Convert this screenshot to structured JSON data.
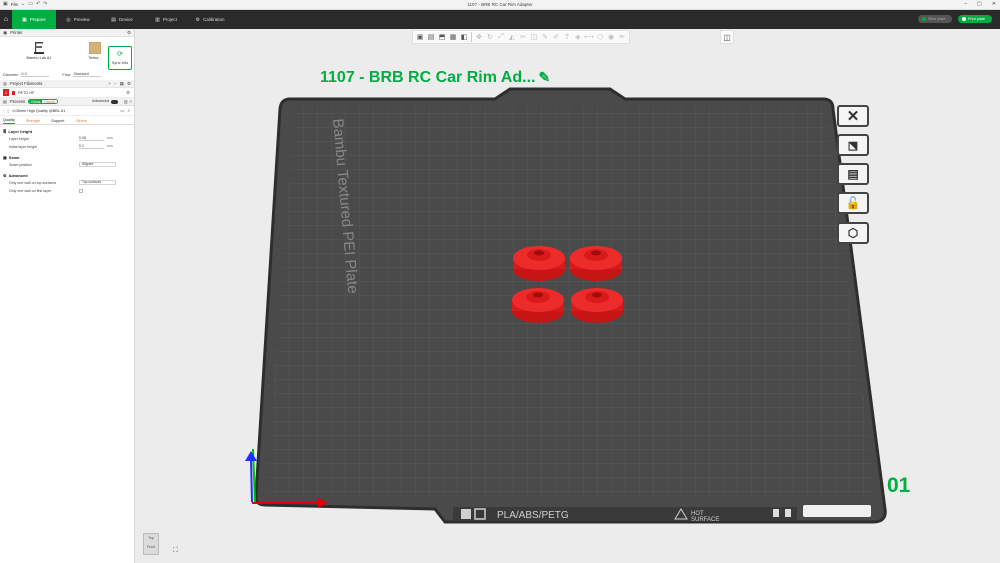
{
  "titlebar": {
    "title": "1107 - BRB RC Car Rim Adapter",
    "file_label": "File",
    "icons": [
      "chevron-down-icon",
      "save-icon",
      "undo-icon",
      "redo-icon"
    ],
    "window_controls": [
      "minimize-icon",
      "maximize-icon",
      "close-icon"
    ]
  },
  "nav": {
    "tabs": [
      {
        "label": "Prepare",
        "icon": "prepare-icon",
        "active": true
      },
      {
        "label": "Preview",
        "icon": "preview-icon",
        "active": false
      },
      {
        "label": "Device",
        "icon": "device-icon",
        "active": false
      },
      {
        "label": "Project",
        "icon": "project-icon",
        "active": false
      },
      {
        "label": "Calibration",
        "icon": "calibration-icon",
        "active": false
      }
    ],
    "slice_label": "Slice plate",
    "print_label": "Print plate"
  },
  "sidebar": {
    "printer_section": "Printer",
    "printer_name": "Bambu Lab A1",
    "plate_name": "Textur...",
    "sync_label": "Sync info",
    "nozzle_label": "Diameter",
    "nozzle_value": "0.4",
    "flow_label": "Flow",
    "flow_value": "Standard",
    "filament_section": "Project Filaments",
    "filament_num": "1",
    "filament_name": "PETG HF",
    "process_section": "Process",
    "toggle_global": "Global",
    "toggle_objects": "Objects",
    "advanced_label": "Advanced",
    "preset_name": "0.08mm High Quality @BBL A1",
    "tabs": [
      "Quality",
      "Strength",
      "Support",
      "Others"
    ],
    "groups": [
      {
        "title": "Layer height",
        "rows": [
          {
            "label": "Layer height",
            "value": "0.08",
            "unit": "mm"
          },
          {
            "label": "Initial layer height",
            "value": "0.2",
            "unit": "mm"
          }
        ]
      },
      {
        "title": "Seam",
        "rows": [
          {
            "label": "Seam position",
            "dropdown": "Aligned"
          }
        ]
      },
      {
        "title": "Advanced",
        "rows": [
          {
            "label": "Only one wall on top surfaces",
            "dropdown": "Top surfaces"
          },
          {
            "label": "Only one wall on first layer"
          }
        ]
      }
    ]
  },
  "viewport": {
    "plate_title": "1107 - BRB RC Car Rim Ad...",
    "plate_number": "01",
    "bed_label": "Bambu Textured PEI Plate",
    "bed_materials": "PLA/ABS/PETG",
    "hot_surface": "HOT\nSURFACE",
    "view_top": "Top",
    "view_front": "Front",
    "part_color": "#ee1c1c",
    "accent": "#00ae42"
  }
}
